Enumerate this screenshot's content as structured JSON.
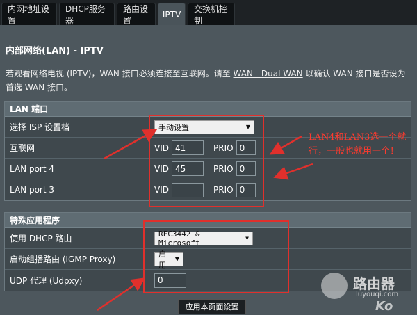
{
  "tabs": [
    "内网地址设置",
    "DHCP服务器",
    "路由设置",
    "IPTV",
    "交换机控制"
  ],
  "active_tab": "IPTV",
  "page": {
    "title": "内部网络(LAN) - IPTV",
    "intro_before": "若观看网络电视 (IPTV)，WAN 接口必须连接至互联网。请至 ",
    "intro_link": "WAN - Dual WAN",
    "intro_after": " 以确认 WAN 接口是否设为首选 WAN 接口。"
  },
  "lan_section": {
    "header": "LAN 端口",
    "isp_label": "选择 ISP 设置档",
    "isp_value": "手动设置",
    "rows": [
      {
        "label": "互联网",
        "vid_label": "VID",
        "vid": "41",
        "prio_label": "PRIO",
        "prio": "0"
      },
      {
        "label": "LAN port 4",
        "vid_label": "VID",
        "vid": "45",
        "prio_label": "PRIO",
        "prio": "0"
      },
      {
        "label": "LAN port 3",
        "vid_label": "VID",
        "vid": "",
        "prio_label": "PRIO",
        "prio": "0"
      }
    ]
  },
  "special_section": {
    "header": "特殊应用程序",
    "dhcp_label": "使用 DHCP 路由",
    "dhcp_value": "RFC3442 & Microsoft",
    "igmp_label": "启动组播路由 (IGMP Proxy)",
    "igmp_value": "启用",
    "udpxy_label": "UDP 代理 (Udpxy)",
    "udpxy_value": "0"
  },
  "apply_button": "应用本页面设置",
  "annotation": "LAN4和LAN3选一个就行，一般也就用一个！",
  "watermark": {
    "text": "路由器",
    "sub": "luyouqi.com",
    "tag": "Ko"
  },
  "colors": {
    "annotation_red": "#e0302c",
    "panel": "#4d575d"
  }
}
